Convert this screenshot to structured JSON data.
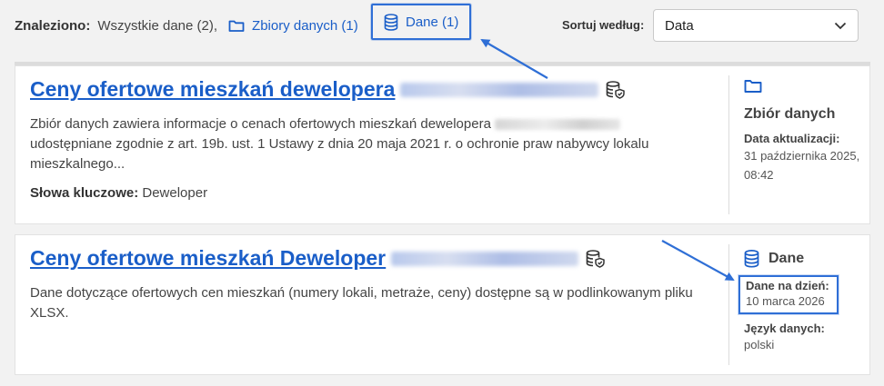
{
  "filters": {
    "found_label": "Znaleziono:",
    "all_label": "Wszystkie dane (2),",
    "datasets_label": "Zbiory danych (1)",
    "data_label": "Dane (1)"
  },
  "sort": {
    "label": "Sortuj według:",
    "selected": "Data"
  },
  "results": [
    {
      "title": "Ceny ofertowe mieszkań dewelopera",
      "description_part1": "Zbiór danych zawiera informacje o cenach ofertowych mieszkań dewelopera",
      "description_part2": "udostępniane zgodnie z art. 19b. ust. 1 Ustawy z dnia 20 maja 2021 r. o ochronie praw nabywcy lokalu mieszkalnego...",
      "keywords_label": "Słowa kluczowe:",
      "keywords": "Deweloper",
      "type": "Zbiór danych",
      "meta_label": "Data aktualizacji:",
      "meta_value": "31 października 2025, 08:42"
    },
    {
      "title": "Ceny ofertowe mieszkań Deweloper",
      "description": "Dane dotyczące ofertowych cen mieszkań (numery lokali, metraże, ceny) dostępne są w podlinkowanym pliku XLSX.",
      "type": "Dane",
      "meta_label": "Dane na dzień:",
      "meta_value": "10 marca 2026",
      "lang_label": "Język danych:",
      "lang_value": "polski"
    }
  ],
  "colors": {
    "link": "#1a5ec8",
    "highlight": "#2f6fd6",
    "background": "#f2f2f2"
  },
  "icons": [
    "folder-icon",
    "database-icon",
    "database-shield-icon",
    "chevron-down-icon"
  ]
}
